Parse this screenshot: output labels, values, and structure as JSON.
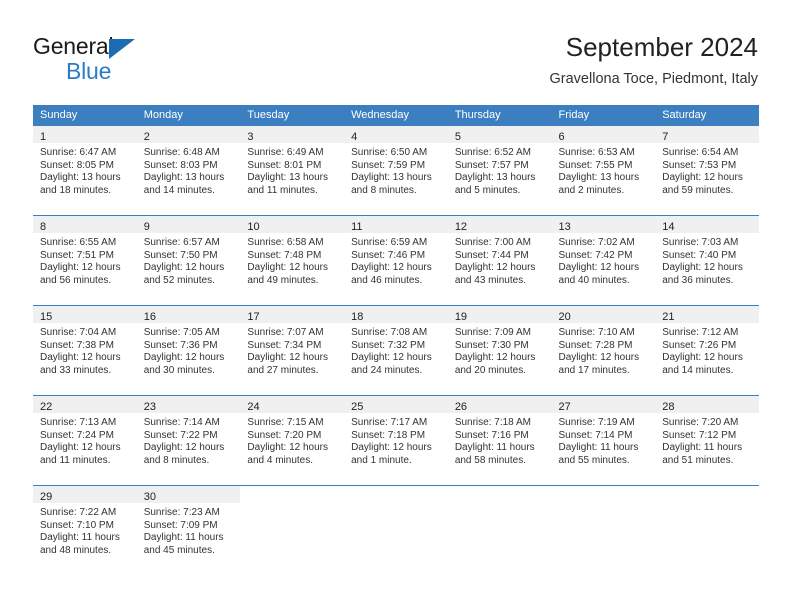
{
  "brand": {
    "name_part1": "General",
    "name_part2": "Blue",
    "logo_icon": "triangle-flag-icon",
    "accent_color": "#1b6cb3",
    "secondary_color": "#2a7cc7"
  },
  "header": {
    "title": "September 2024",
    "subtitle": "Gravellona Toce, Piedmont, Italy"
  },
  "calendar": {
    "header_bg": "#3c7fc0",
    "day_band_bg": "#f0f0f0",
    "day_names": [
      "Sunday",
      "Monday",
      "Tuesday",
      "Wednesday",
      "Thursday",
      "Friday",
      "Saturday"
    ],
    "weeks": [
      [
        {
          "day": "1",
          "sunrise": "Sunrise: 6:47 AM",
          "sunset": "Sunset: 8:05 PM",
          "daylight1": "Daylight: 13 hours",
          "daylight2": "and 18 minutes."
        },
        {
          "day": "2",
          "sunrise": "Sunrise: 6:48 AM",
          "sunset": "Sunset: 8:03 PM",
          "daylight1": "Daylight: 13 hours",
          "daylight2": "and 14 minutes."
        },
        {
          "day": "3",
          "sunrise": "Sunrise: 6:49 AM",
          "sunset": "Sunset: 8:01 PM",
          "daylight1": "Daylight: 13 hours",
          "daylight2": "and 11 minutes."
        },
        {
          "day": "4",
          "sunrise": "Sunrise: 6:50 AM",
          "sunset": "Sunset: 7:59 PM",
          "daylight1": "Daylight: 13 hours",
          "daylight2": "and 8 minutes."
        },
        {
          "day": "5",
          "sunrise": "Sunrise: 6:52 AM",
          "sunset": "Sunset: 7:57 PM",
          "daylight1": "Daylight: 13 hours",
          "daylight2": "and 5 minutes."
        },
        {
          "day": "6",
          "sunrise": "Sunrise: 6:53 AM",
          "sunset": "Sunset: 7:55 PM",
          "daylight1": "Daylight: 13 hours",
          "daylight2": "and 2 minutes."
        },
        {
          "day": "7",
          "sunrise": "Sunrise: 6:54 AM",
          "sunset": "Sunset: 7:53 PM",
          "daylight1": "Daylight: 12 hours",
          "daylight2": "and 59 minutes."
        }
      ],
      [
        {
          "day": "8",
          "sunrise": "Sunrise: 6:55 AM",
          "sunset": "Sunset: 7:51 PM",
          "daylight1": "Daylight: 12 hours",
          "daylight2": "and 56 minutes."
        },
        {
          "day": "9",
          "sunrise": "Sunrise: 6:57 AM",
          "sunset": "Sunset: 7:50 PM",
          "daylight1": "Daylight: 12 hours",
          "daylight2": "and 52 minutes."
        },
        {
          "day": "10",
          "sunrise": "Sunrise: 6:58 AM",
          "sunset": "Sunset: 7:48 PM",
          "daylight1": "Daylight: 12 hours",
          "daylight2": "and 49 minutes."
        },
        {
          "day": "11",
          "sunrise": "Sunrise: 6:59 AM",
          "sunset": "Sunset: 7:46 PM",
          "daylight1": "Daylight: 12 hours",
          "daylight2": "and 46 minutes."
        },
        {
          "day": "12",
          "sunrise": "Sunrise: 7:00 AM",
          "sunset": "Sunset: 7:44 PM",
          "daylight1": "Daylight: 12 hours",
          "daylight2": "and 43 minutes."
        },
        {
          "day": "13",
          "sunrise": "Sunrise: 7:02 AM",
          "sunset": "Sunset: 7:42 PM",
          "daylight1": "Daylight: 12 hours",
          "daylight2": "and 40 minutes."
        },
        {
          "day": "14",
          "sunrise": "Sunrise: 7:03 AM",
          "sunset": "Sunset: 7:40 PM",
          "daylight1": "Daylight: 12 hours",
          "daylight2": "and 36 minutes."
        }
      ],
      [
        {
          "day": "15",
          "sunrise": "Sunrise: 7:04 AM",
          "sunset": "Sunset: 7:38 PM",
          "daylight1": "Daylight: 12 hours",
          "daylight2": "and 33 minutes."
        },
        {
          "day": "16",
          "sunrise": "Sunrise: 7:05 AM",
          "sunset": "Sunset: 7:36 PM",
          "daylight1": "Daylight: 12 hours",
          "daylight2": "and 30 minutes."
        },
        {
          "day": "17",
          "sunrise": "Sunrise: 7:07 AM",
          "sunset": "Sunset: 7:34 PM",
          "daylight1": "Daylight: 12 hours",
          "daylight2": "and 27 minutes."
        },
        {
          "day": "18",
          "sunrise": "Sunrise: 7:08 AM",
          "sunset": "Sunset: 7:32 PM",
          "daylight1": "Daylight: 12 hours",
          "daylight2": "and 24 minutes."
        },
        {
          "day": "19",
          "sunrise": "Sunrise: 7:09 AM",
          "sunset": "Sunset: 7:30 PM",
          "daylight1": "Daylight: 12 hours",
          "daylight2": "and 20 minutes."
        },
        {
          "day": "20",
          "sunrise": "Sunrise: 7:10 AM",
          "sunset": "Sunset: 7:28 PM",
          "daylight1": "Daylight: 12 hours",
          "daylight2": "and 17 minutes."
        },
        {
          "day": "21",
          "sunrise": "Sunrise: 7:12 AM",
          "sunset": "Sunset: 7:26 PM",
          "daylight1": "Daylight: 12 hours",
          "daylight2": "and 14 minutes."
        }
      ],
      [
        {
          "day": "22",
          "sunrise": "Sunrise: 7:13 AM",
          "sunset": "Sunset: 7:24 PM",
          "daylight1": "Daylight: 12 hours",
          "daylight2": "and 11 minutes."
        },
        {
          "day": "23",
          "sunrise": "Sunrise: 7:14 AM",
          "sunset": "Sunset: 7:22 PM",
          "daylight1": "Daylight: 12 hours",
          "daylight2": "and 8 minutes."
        },
        {
          "day": "24",
          "sunrise": "Sunrise: 7:15 AM",
          "sunset": "Sunset: 7:20 PM",
          "daylight1": "Daylight: 12 hours",
          "daylight2": "and 4 minutes."
        },
        {
          "day": "25",
          "sunrise": "Sunrise: 7:17 AM",
          "sunset": "Sunset: 7:18 PM",
          "daylight1": "Daylight: 12 hours",
          "daylight2": "and 1 minute."
        },
        {
          "day": "26",
          "sunrise": "Sunrise: 7:18 AM",
          "sunset": "Sunset: 7:16 PM",
          "daylight1": "Daylight: 11 hours",
          "daylight2": "and 58 minutes."
        },
        {
          "day": "27",
          "sunrise": "Sunrise: 7:19 AM",
          "sunset": "Sunset: 7:14 PM",
          "daylight1": "Daylight: 11 hours",
          "daylight2": "and 55 minutes."
        },
        {
          "day": "28",
          "sunrise": "Sunrise: 7:20 AM",
          "sunset": "Sunset: 7:12 PM",
          "daylight1": "Daylight: 11 hours",
          "daylight2": "and 51 minutes."
        }
      ],
      [
        {
          "day": "29",
          "sunrise": "Sunrise: 7:22 AM",
          "sunset": "Sunset: 7:10 PM",
          "daylight1": "Daylight: 11 hours",
          "daylight2": "and 48 minutes."
        },
        {
          "day": "30",
          "sunrise": "Sunrise: 7:23 AM",
          "sunset": "Sunset: 7:09 PM",
          "daylight1": "Daylight: 11 hours",
          "daylight2": "and 45 minutes."
        },
        {
          "day": "",
          "sunrise": "",
          "sunset": "",
          "daylight1": "",
          "daylight2": ""
        },
        {
          "day": "",
          "sunrise": "",
          "sunset": "",
          "daylight1": "",
          "daylight2": ""
        },
        {
          "day": "",
          "sunrise": "",
          "sunset": "",
          "daylight1": "",
          "daylight2": ""
        },
        {
          "day": "",
          "sunrise": "",
          "sunset": "",
          "daylight1": "",
          "daylight2": ""
        },
        {
          "day": "",
          "sunrise": "",
          "sunset": "",
          "daylight1": "",
          "daylight2": ""
        }
      ]
    ]
  }
}
